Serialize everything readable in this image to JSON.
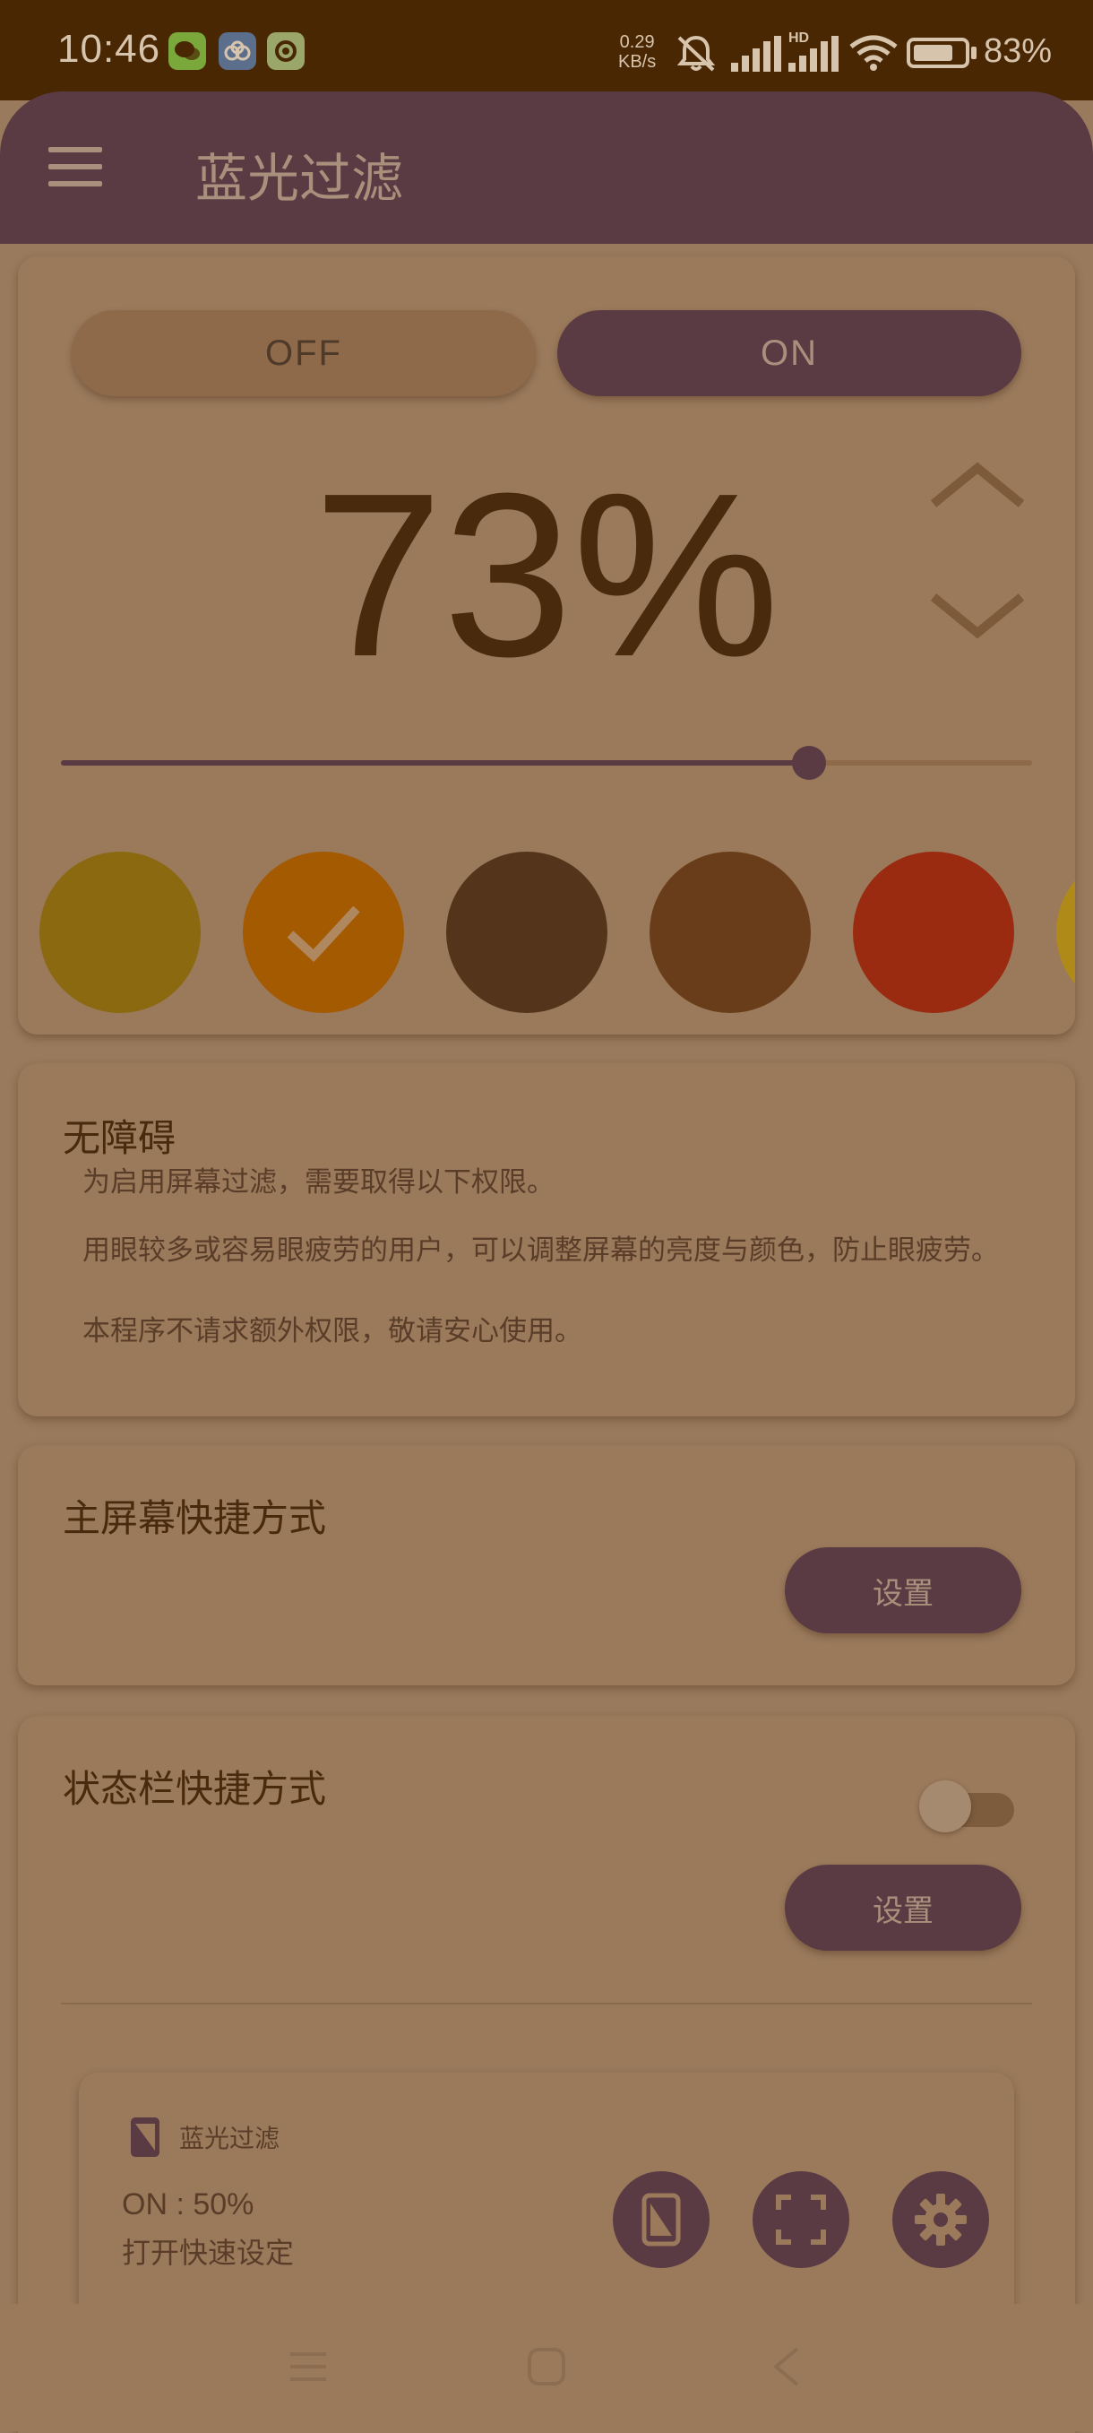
{
  "status_bar": {
    "time": "10:46",
    "net_speed_value": "0.29",
    "net_speed_unit": "KB/s",
    "signal_hd_label": "HD",
    "battery_level": 0.83,
    "battery_text": "83%",
    "app_icons": [
      "wechat-icon",
      "baidu-netdisk-icon",
      "quark-icon"
    ]
  },
  "app_bar": {
    "title": "蓝光过滤"
  },
  "filter_card": {
    "off_label": "OFF",
    "on_label": "ON",
    "intensity_text": "73%",
    "intensity_value": 73,
    "slider": {
      "value": 0.77
    },
    "swatches": [
      {
        "color": "#8a6911",
        "selected": false
      },
      {
        "color": "#a35a00",
        "selected": true
      },
      {
        "color": "#54341a",
        "selected": false
      },
      {
        "color": "#6a3d1a",
        "selected": false
      },
      {
        "color": "#9a2a10",
        "selected": false
      },
      {
        "color": "#b08a18",
        "selected": false
      }
    ]
  },
  "accessibility_card": {
    "title": "无障碍",
    "line1": "为启用屏幕过滤，需要取得以下权限。",
    "line2": "用眼较多或容易眼疲劳的用户，可以调整屏幕的亮度与颜色，防止眼疲劳。",
    "line3": "本程序不请求额外权限，敬请安心使用。"
  },
  "home_shortcut_card": {
    "title": "主屏幕快捷方式",
    "button_label": "设置"
  },
  "status_shortcut_card": {
    "title": "状态栏快捷方式",
    "switch_on": false,
    "button_label": "设置",
    "preview": {
      "app_name": "蓝光过滤",
      "status": "ON : 50%",
      "hint": "打开快速设定"
    }
  }
}
